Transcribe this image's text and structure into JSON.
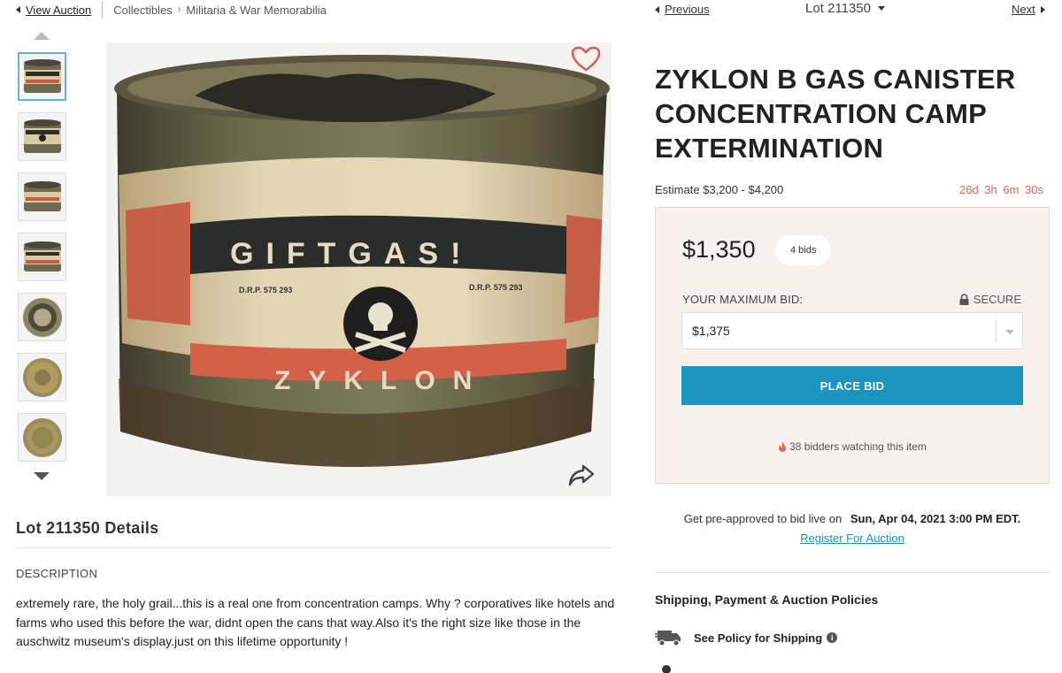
{
  "breadcrumb": {
    "back_label": "View Auction",
    "items": [
      "Collectibles",
      "Militaria & War Memorabilia"
    ]
  },
  "lot_nav": {
    "previous_label": "Previous",
    "lot_label": "Lot 211350",
    "next_label": "Next"
  },
  "gallery": {
    "thumbnail_count": 7,
    "selected_index": 0,
    "image_text": {
      "label_top": "GIFTGAS!",
      "label_bottom": "ZYKLON",
      "drp_left": "D.R.P. 575 293",
      "drp_right": "D.R.P. 575 293"
    }
  },
  "lot": {
    "title": "ZYKLON B GAS CANISTER CONCENTRATION CAMP EXTERMINATION",
    "estimate": "Estimate $3,200 - $4,200",
    "time_left": "26d 3h 6m 30s"
  },
  "bid": {
    "current_price": "$1,350",
    "bids_count": "4 bids",
    "max_bid_label": "YOUR MAXIMUM BID:",
    "secure_label": "SECURE",
    "selected_amount": "$1,375",
    "place_bid_label": "PLACE BID",
    "watching_text": "38 bidders watching this item"
  },
  "live": {
    "preapprove_text": "Get pre-approved to bid live on",
    "date_text": "Sun, Apr 04, 2021 3:00 PM EDT.",
    "register_label": "Register For Auction"
  },
  "policies": {
    "heading": "Shipping, Payment & Auction Policies",
    "shipping_label": "See Policy for Shipping"
  },
  "details": {
    "heading": "Lot 211350 Details",
    "description_heading": "DESCRIPTION",
    "description": "extremely rare, the holy grail...this is a real one from concentration camps. Why ? corporatives like hotels and farms who used this before the war, didnt open the cans that way.Also it's the right size like those in the auschwitz museum's display.just on this lifetime opportunity !"
  },
  "colors": {
    "accent": "#1b94be",
    "timer": "#e0675a",
    "heart": "#e05a55",
    "bid_box": "#f8f1ee"
  }
}
